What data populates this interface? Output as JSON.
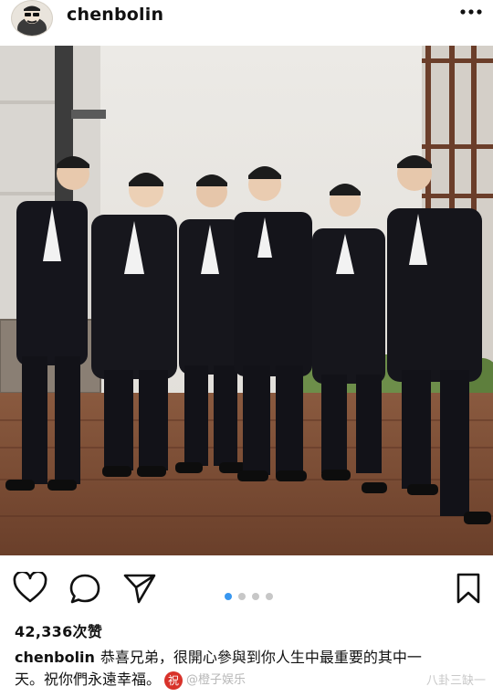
{
  "post": {
    "username": "chenbolin",
    "more_icon": "more-horizontal-icon"
  },
  "carousel": {
    "total": 4,
    "active_index": 0,
    "active_color": "#3897f0"
  },
  "actions": {
    "like_icon": "heart-icon",
    "comment_icon": "comment-bubble-icon",
    "share_icon": "paper-plane-icon",
    "save_icon": "bookmark-icon"
  },
  "likes_text": "42,336次赞",
  "caption": {
    "username": "chenbolin",
    "line1": "恭喜兄弟，很開心參與到你人生中最重要的其中一",
    "line2": "天。祝你們永遠幸福。",
    "badge": "祝"
  },
  "watermarks": {
    "weibo": "@橙子娱乐",
    "corner": "八卦三缺一"
  }
}
